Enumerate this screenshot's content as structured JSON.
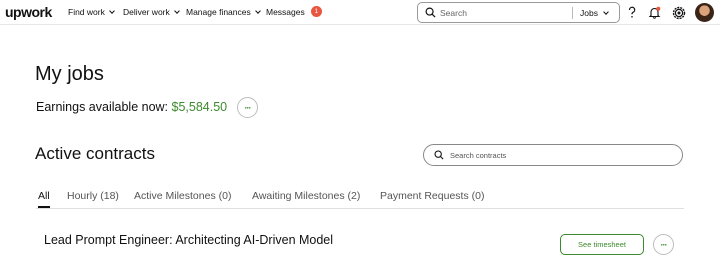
{
  "nav": {
    "logo": "upwork",
    "items": [
      {
        "label": "Find work"
      },
      {
        "label": "Deliver work"
      },
      {
        "label": "Manage finances"
      }
    ],
    "messages": {
      "label": "Messages",
      "badge": "1"
    },
    "search": {
      "placeholder": "Search",
      "scope": "Jobs"
    },
    "icons": [
      "help-icon",
      "notifications-icon",
      "settings-icon",
      "avatar"
    ]
  },
  "main": {
    "title": "My jobs",
    "earnings_label": "Earnings available now:",
    "earnings_amount": "$5,584.50",
    "more_label": "···",
    "section_title": "Active contracts",
    "contract_search_placeholder": "Search contracts",
    "tabs": [
      {
        "label": "All",
        "active": true
      },
      {
        "label": "Hourly (18)"
      },
      {
        "label": "Active Milestones (0)"
      },
      {
        "label": "Awaiting Milestones (2)"
      },
      {
        "label": "Payment Requests (0)"
      }
    ],
    "contract": {
      "title": "Lead Prompt Engineer: Architecting AI-Driven Model",
      "timesheet_label": "See timesheet"
    }
  },
  "colors": {
    "brand": "#111111",
    "accent_green": "#3c8a2e",
    "badge": "#e8563f"
  }
}
